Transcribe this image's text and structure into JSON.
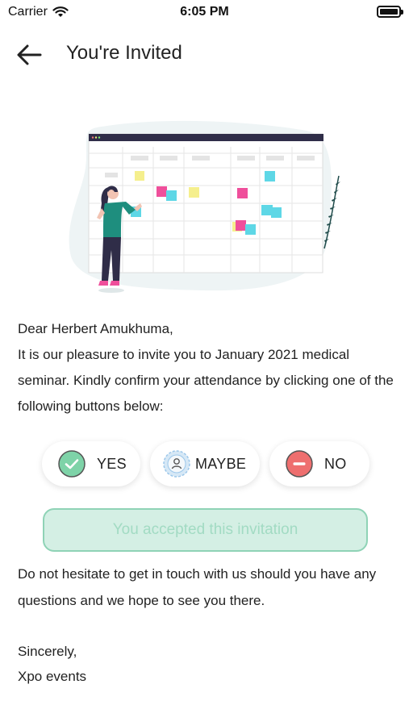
{
  "status_bar": {
    "carrier": "Carrier",
    "time": "6:05 PM"
  },
  "header": {
    "title": "You're Invited",
    "back_icon": "arrow-left-icon"
  },
  "illustration": {
    "name": "calendar-planning-illustration"
  },
  "message": {
    "greeting": "Dear Herbert Amukhuma,",
    "body": "It is our pleasure to invite you to January 2021 medical seminar. Kindly confirm your attendance by clicking one of the following buttons below:"
  },
  "rsvp": {
    "yes": {
      "label": "YES",
      "icon": "check-circle-icon",
      "color": "#7ed3a8"
    },
    "maybe": {
      "label": "MAYBE",
      "icon": "person-circle-icon",
      "color": "#9cc7ea"
    },
    "no": {
      "label": "NO",
      "icon": "minus-circle-icon",
      "color": "#ee6f6f"
    }
  },
  "status_message": "You accepted this invitation",
  "closing": "Do not hesitate to get in touch with us should you have any questions and we hope to see you there.",
  "signoff": {
    "line1": "Sincerely,",
    "line2": "Xpo events"
  },
  "colors": {
    "accent": "#8fd3b6",
    "banner_bg": "#d4efe4",
    "banner_text": "#a2dbc3"
  }
}
